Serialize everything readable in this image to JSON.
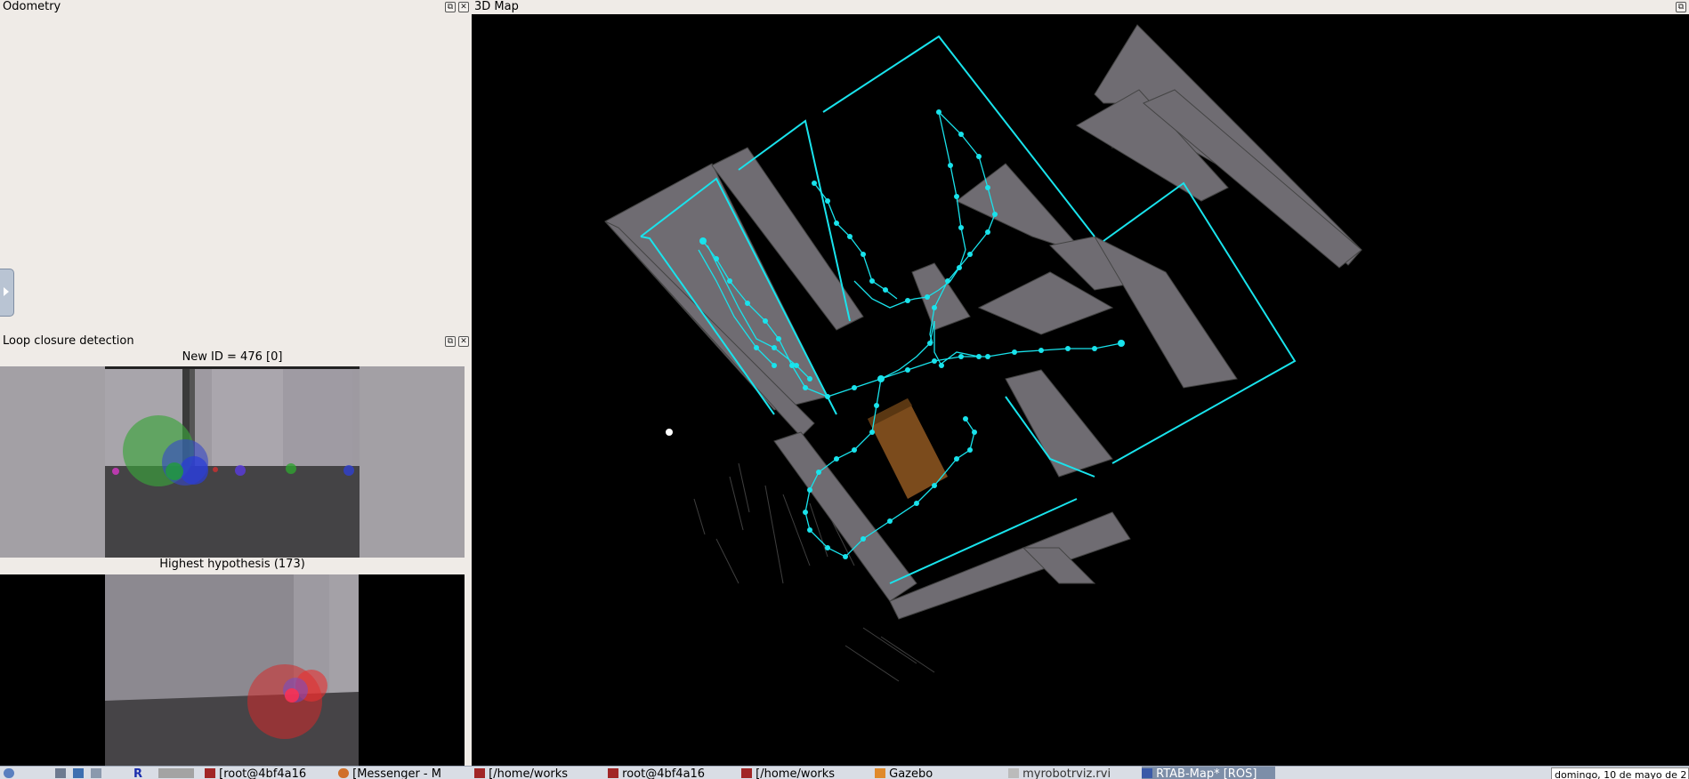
{
  "odometry": {
    "title": "Odometry"
  },
  "loop_closure": {
    "title": "Loop closure detection",
    "new_id_label": "New ID = 476 [0]",
    "hypothesis_label": "Highest hypothesis (173)"
  },
  "map3d": {
    "title": "3D Map",
    "path_color": "#19e3ec",
    "wall_color": "#6f6c72"
  },
  "taskbar": {
    "items": [
      {
        "label": "[root@4bf4a16",
        "icon": "terminal-icon"
      },
      {
        "label": "[Messenger - M",
        "icon": "firefox-icon"
      },
      {
        "label": "[/home/works",
        "icon": "terminal-icon"
      },
      {
        "label": "root@4bf4a16",
        "icon": "terminal-icon"
      },
      {
        "label": "[/home/works",
        "icon": "terminal-icon"
      },
      {
        "label": "Gazebo",
        "icon": "gazebo-icon"
      },
      {
        "label": "myrobotrviz.rvi",
        "icon": "rviz-icon"
      },
      {
        "label": "RTAB-Map* [ROS]",
        "icon": "rtabmap-icon"
      }
    ],
    "clock": "domingo, 10 de mayo de 2"
  }
}
